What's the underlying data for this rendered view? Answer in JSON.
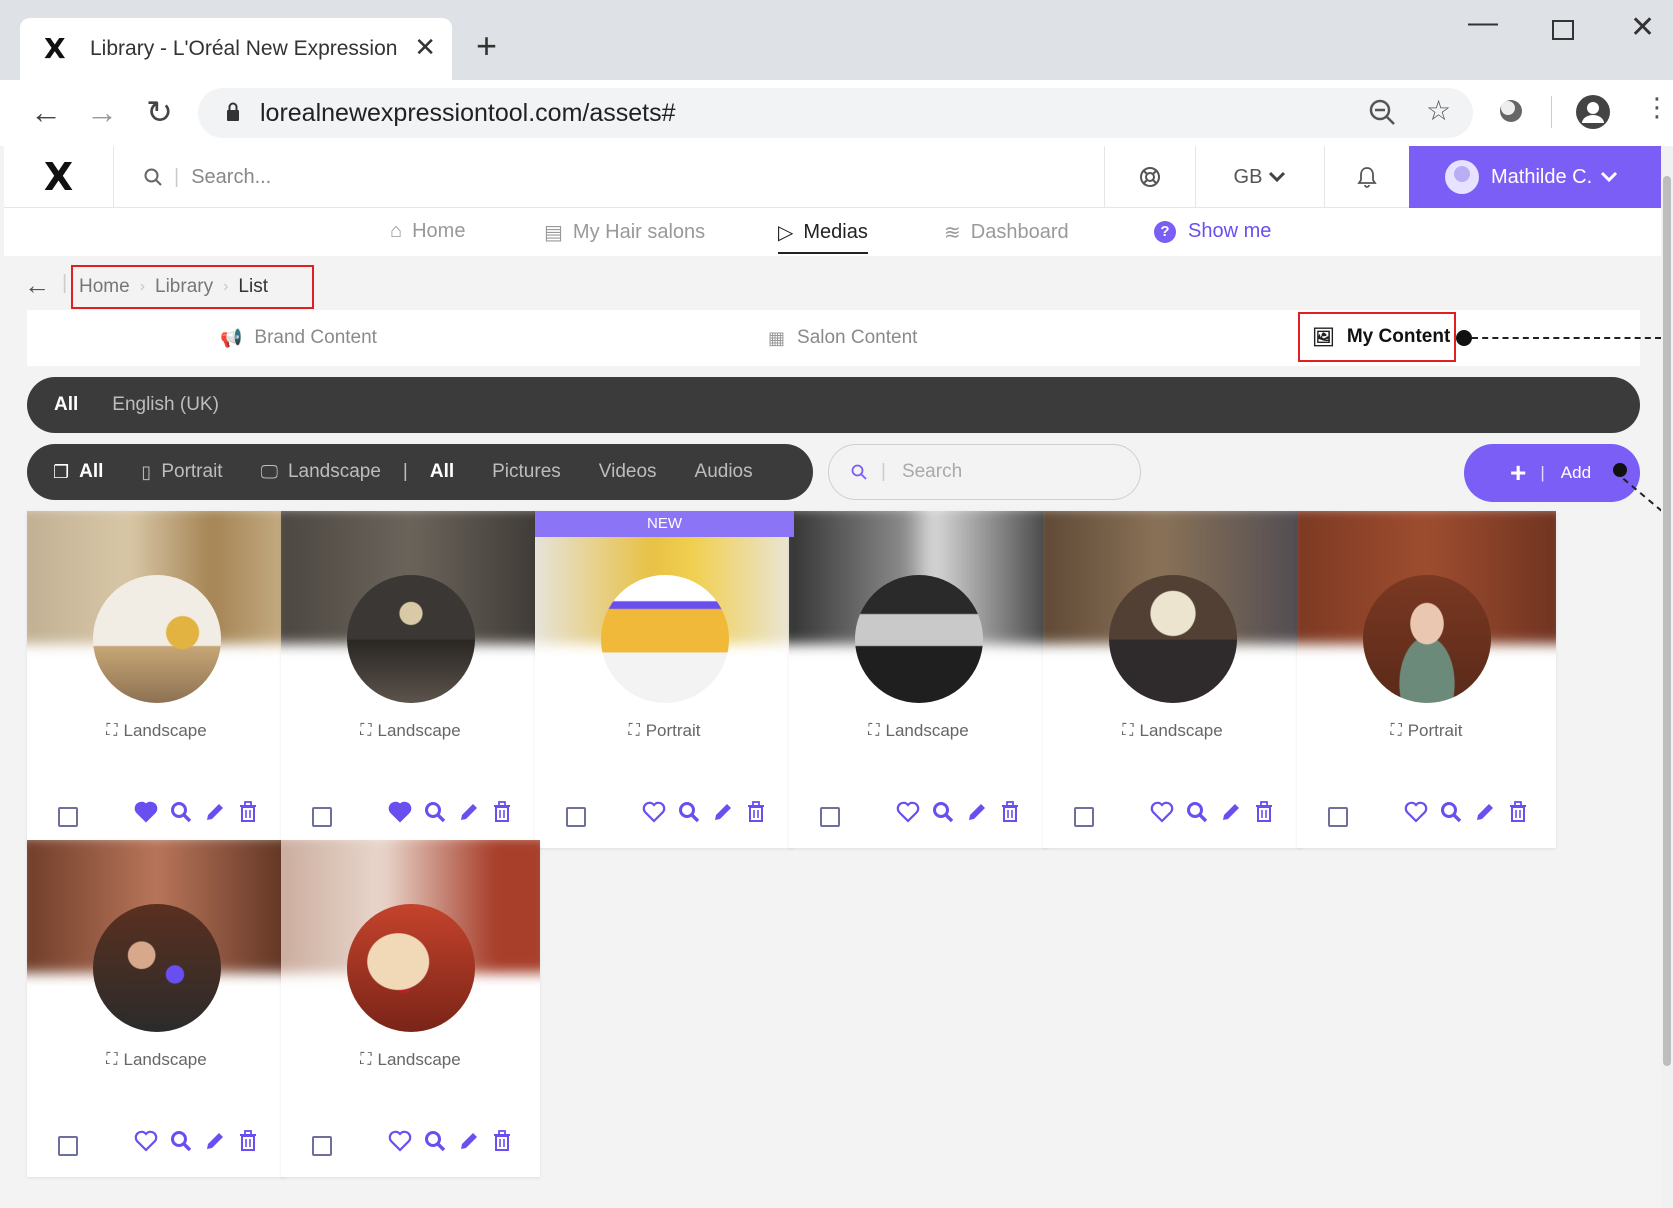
{
  "browser": {
    "tab_title": "Library - L'Oréal New Expression Tool",
    "url": "lorealnewexpressiontool.com/assets#",
    "new_tab_label": "+",
    "tab_close_label": "✕"
  },
  "header": {
    "search_placeholder": "Search...",
    "language": "GB",
    "user_name": "Mathilde C."
  },
  "main_nav": {
    "items": [
      {
        "label": "Home",
        "icon": "home-icon"
      },
      {
        "label": "My Hair salons",
        "icon": "store-icon"
      },
      {
        "label": "Medias",
        "icon": "play-icon"
      },
      {
        "label": "Dashboard",
        "icon": "layers-icon"
      }
    ],
    "active": "Medias",
    "show_me_label": "Show me"
  },
  "breadcrumb": {
    "items": [
      "Home",
      "Library",
      "List"
    ]
  },
  "content_tabs": {
    "items": [
      {
        "label": "Brand Content",
        "icon": "megaphone-icon"
      },
      {
        "label": "Salon Content",
        "icon": "film-icon"
      },
      {
        "label": "My Content",
        "icon": "images-icon"
      }
    ],
    "active": "My Content"
  },
  "language_filter": {
    "items": [
      "All",
      "English (UK)"
    ],
    "active": "All"
  },
  "format_filter": {
    "items": [
      {
        "label": "All",
        "icon": "copy-icon"
      },
      {
        "label": "Portrait",
        "icon": "portrait-icon"
      },
      {
        "label": "Landscape",
        "icon": "monitor-icon"
      }
    ],
    "active": "All"
  },
  "type_filter": {
    "items": [
      "All",
      "Pictures",
      "Videos",
      "Audios"
    ],
    "active": "All"
  },
  "search": {
    "placeholder": "Search"
  },
  "add_button": {
    "label": "Add"
  },
  "cards": [
    {
      "orientation": "Landscape",
      "liked": true,
      "badge": "",
      "theme": "sunflower-room"
    },
    {
      "orientation": "Landscape",
      "liked": true,
      "badge": "",
      "theme": "salon-chairs"
    },
    {
      "orientation": "Portrait",
      "liked": false,
      "badge": "NEW",
      "theme": "screen-promo"
    },
    {
      "orientation": "Landscape",
      "liked": false,
      "badge": "",
      "theme": "dark-salon"
    },
    {
      "orientation": "Landscape",
      "liked": false,
      "badge": "",
      "theme": "salon-interior"
    },
    {
      "orientation": "Portrait",
      "liked": false,
      "badge": "",
      "theme": "woman-portrait"
    },
    {
      "orientation": "Landscape",
      "liked": false,
      "badge": "",
      "theme": "stylist-tablet"
    },
    {
      "orientation": "Landscape",
      "liked": false,
      "badge": "",
      "theme": "blonde-hair"
    }
  ],
  "colors": {
    "accent": "#7b5ef5",
    "dark_bar": "#3b3b3b",
    "annotation_red": "#e02020"
  }
}
